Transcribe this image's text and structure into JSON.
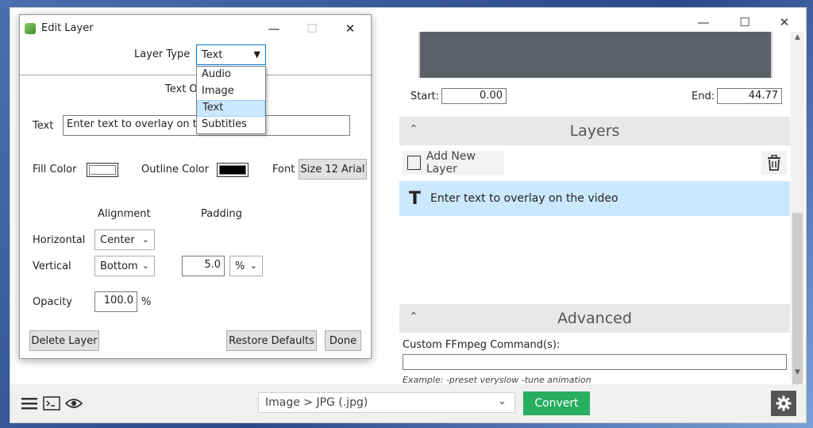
{
  "main": {
    "start_label": "Start:",
    "start_value": "0.00",
    "end_label": "End:",
    "end_value": "44.77",
    "layers_section_title": "Layers",
    "add_layer_label": "Add New Layer",
    "layer_items": [
      {
        "label": "Enter text to overlay on the video",
        "icon": "text-t-icon"
      }
    ],
    "advanced_section_title": "Advanced",
    "custom_ffmpeg_label": "Custom FFmpeg Command(s):",
    "custom_ffmpeg_value": "",
    "custom_ffmpeg_example": "Example: -preset veryslow -tune animation",
    "format_selected": "Image > JPG (.jpg)",
    "convert_label": "Convert"
  },
  "dialog": {
    "title": "Edit Layer",
    "layer_type_label": "Layer Type",
    "layer_type_value": "Text",
    "layer_type_options": [
      "Audio",
      "Image",
      "Text",
      "Subtitles"
    ],
    "section_heading": "Text O",
    "text_label": "Text",
    "text_value": "Enter text to overlay on the",
    "fill_color_label": "Fill Color",
    "fill_color": "#ffffff",
    "outline_color_label": "Outline Color",
    "outline_color": "#000000",
    "font_label": "Font",
    "font_button": "Size 12 Arial",
    "alignment_heading": "Alignment",
    "padding_heading": "Padding",
    "horizontal_label": "Horizontal",
    "horizontal_value": "Center",
    "vertical_label": "Vertical",
    "vertical_value": "Bottom",
    "padding_value": "5.0",
    "padding_unit": "%",
    "opacity_label": "Opacity",
    "opacity_value": "100.0",
    "opacity_unit": "%",
    "delete_layer_label": "Delete Layer",
    "restore_defaults_label": "Restore Defaults",
    "done_label": "Done"
  },
  "colors": {
    "convert_green": "#27ae60",
    "selection_blue": "#cce8ff",
    "preview_gray": "#5d6167"
  }
}
